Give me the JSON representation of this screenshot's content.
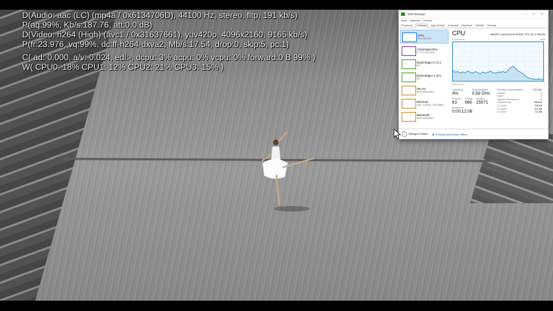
{
  "osd": {
    "line1": "D(Audio: aac (LC) (mp4a / 0x6134706D), 44100 Hz, stereo, fltp, 191 kb/s)",
    "line2": "P(aq:99%, Kb/s:187.76, att:0.0 dB)",
    "line3": "D(Video: h264 (High) (avc1 / 0x31637661), yuv420p, 4096x2160, 9165 kb/s)",
    "line4": "P(fr:23.976, vq:99%, dc:ff-h264-dxva2, Mb/s:17.54, drop:0, skip:5, pc:1)",
    "line5": "C( ad: 0.000, a/v: 0.024, edl:-, dcpu: 3% acpu: 0% vcpu: 0% forward:0 B 99% )",
    "line6": "W( CPU0:  18% CPU1:  12% CPU2:  21% CPU3:  15% )"
  },
  "task_manager": {
    "title": "Task-Manager",
    "menu": [
      "Datei",
      "Optionen",
      "Ansicht"
    ],
    "tabs": [
      "Prozesse",
      "Leistung",
      "App-Verlauf",
      "Autostart",
      "Benutzer",
      "Details",
      "Dienste"
    ],
    "active_tab": "Leistung",
    "sidebar": [
      {
        "name": "CPU",
        "sub": "4% 0,58 GHz",
        "color": "#1a7fd0"
      },
      {
        "name": "Arbeitsspeicher",
        "sub": "2,7/7,9 GB (34%)",
        "color": "#8b2fa5"
      },
      {
        "name": "Datenträger 0 (C:)",
        "sub": "0%",
        "color": "#4c9a2a"
      },
      {
        "name": "Datenträger 1 (D:)",
        "sub": "0%",
        "color": "#4c9a2a"
      },
      {
        "name": "WLAN",
        "sub": "Nicht verbunden",
        "color": "#c98a2a"
      },
      {
        "name": "Ethernet",
        "sub": "Ges.: 0 Empf.: 24,0 KBit/s",
        "color": "#c98a2a"
      },
      {
        "name": "Bluetooth",
        "sub": "Nicht verbunden",
        "color": "#c98a2a"
      }
    ],
    "cpu": {
      "title": "CPU",
      "model": "Intel(R) Core(TM) i5-6100U CPU @ 2,30GHz",
      "graph_label_left": "% Auslastung",
      "graph_label_right": "100%",
      "graph_bottom_left": "60 Sekunden",
      "graph_bottom_right": "0",
      "utilization_label": "Auslastung",
      "utilization": "4%",
      "speed_label": "Geschwindigkeit",
      "speed": "0,58 GHz",
      "processes_label": "Prozesse",
      "processes": "63",
      "threads_label": "Threads",
      "threads": "969",
      "handles_label": "Handles",
      "handles": "25071",
      "uptime_label": "Betriebszeit",
      "uptime": "0:00:12:08",
      "details": [
        {
          "k": "Maximale Geschwindigkeit:",
          "v": "2,30 GHz"
        },
        {
          "k": "Sockets:",
          "v": "1"
        },
        {
          "k": "Kerne:",
          "v": "2"
        },
        {
          "k": "Logische Prozessoren:",
          "v": "4"
        },
        {
          "k": "Virtualisierung:",
          "v": "Aktiviert"
        },
        {
          "k": "L1-Cache:",
          "v": "128 KB"
        },
        {
          "k": "L2-Cache:",
          "v": "512 KB"
        },
        {
          "k": "L3-Cache:",
          "v": "3,0 MB"
        }
      ],
      "history": [
        28,
        22,
        24,
        20,
        23,
        21,
        26,
        22,
        20,
        24,
        21,
        19,
        23,
        20,
        22,
        25,
        21,
        20,
        23,
        22,
        24,
        21,
        27,
        34,
        38,
        32,
        26,
        22,
        18,
        12,
        8,
        6,
        5,
        4,
        5,
        4,
        4
      ]
    },
    "footer": {
      "less_details": "Weniger Details",
      "resource_monitor": "Ressourcenmonitor öffnen"
    }
  }
}
